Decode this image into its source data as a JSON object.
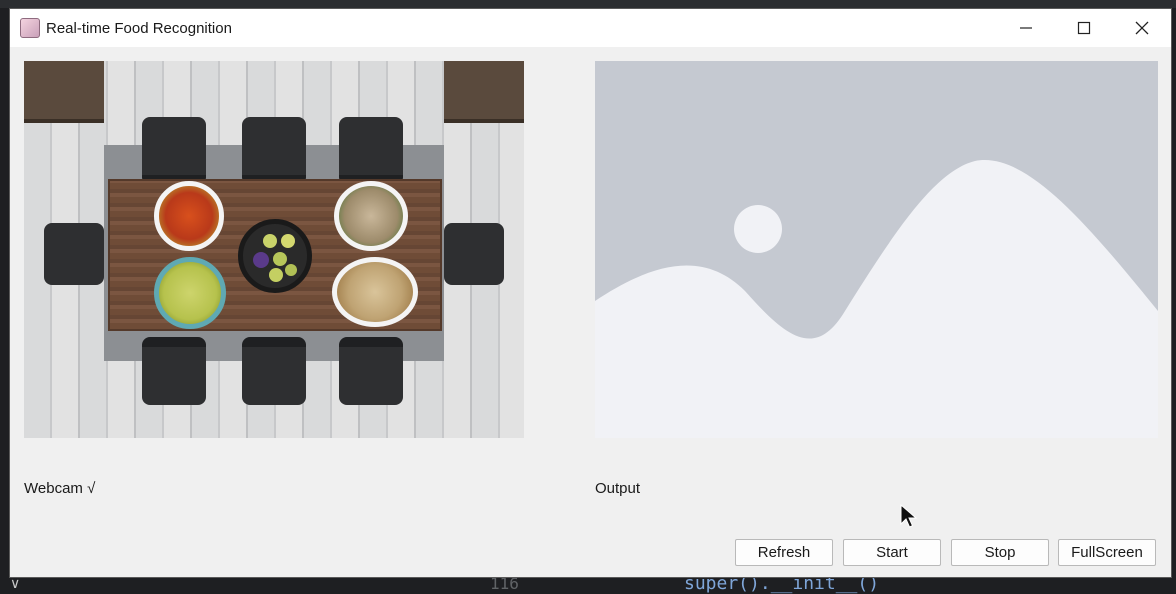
{
  "window": {
    "title": "Real-time Food Recognition",
    "controls": {
      "minimize": "—",
      "maximize": "☐",
      "close": "✕"
    }
  },
  "panels": {
    "webcam_label": "Webcam √",
    "output_label": "Output"
  },
  "buttons": {
    "refresh": "Refresh",
    "start": "Start",
    "stop": "Stop",
    "fullscreen": "FullScreen"
  },
  "background": {
    "code_text": "super().__init__()",
    "line_number": "116",
    "tree_glyph": "∨"
  },
  "colors": {
    "window_bg": "#f0f0f0",
    "titlebar_bg": "#ffffff",
    "placeholder_bg": "#c5c9d1",
    "placeholder_fg": "#f1f2f6"
  },
  "icons": [
    "app-icon",
    "minimize-icon",
    "maximize-icon",
    "close-icon",
    "mouse-cursor-icon",
    "image-placeholder-icon"
  ]
}
